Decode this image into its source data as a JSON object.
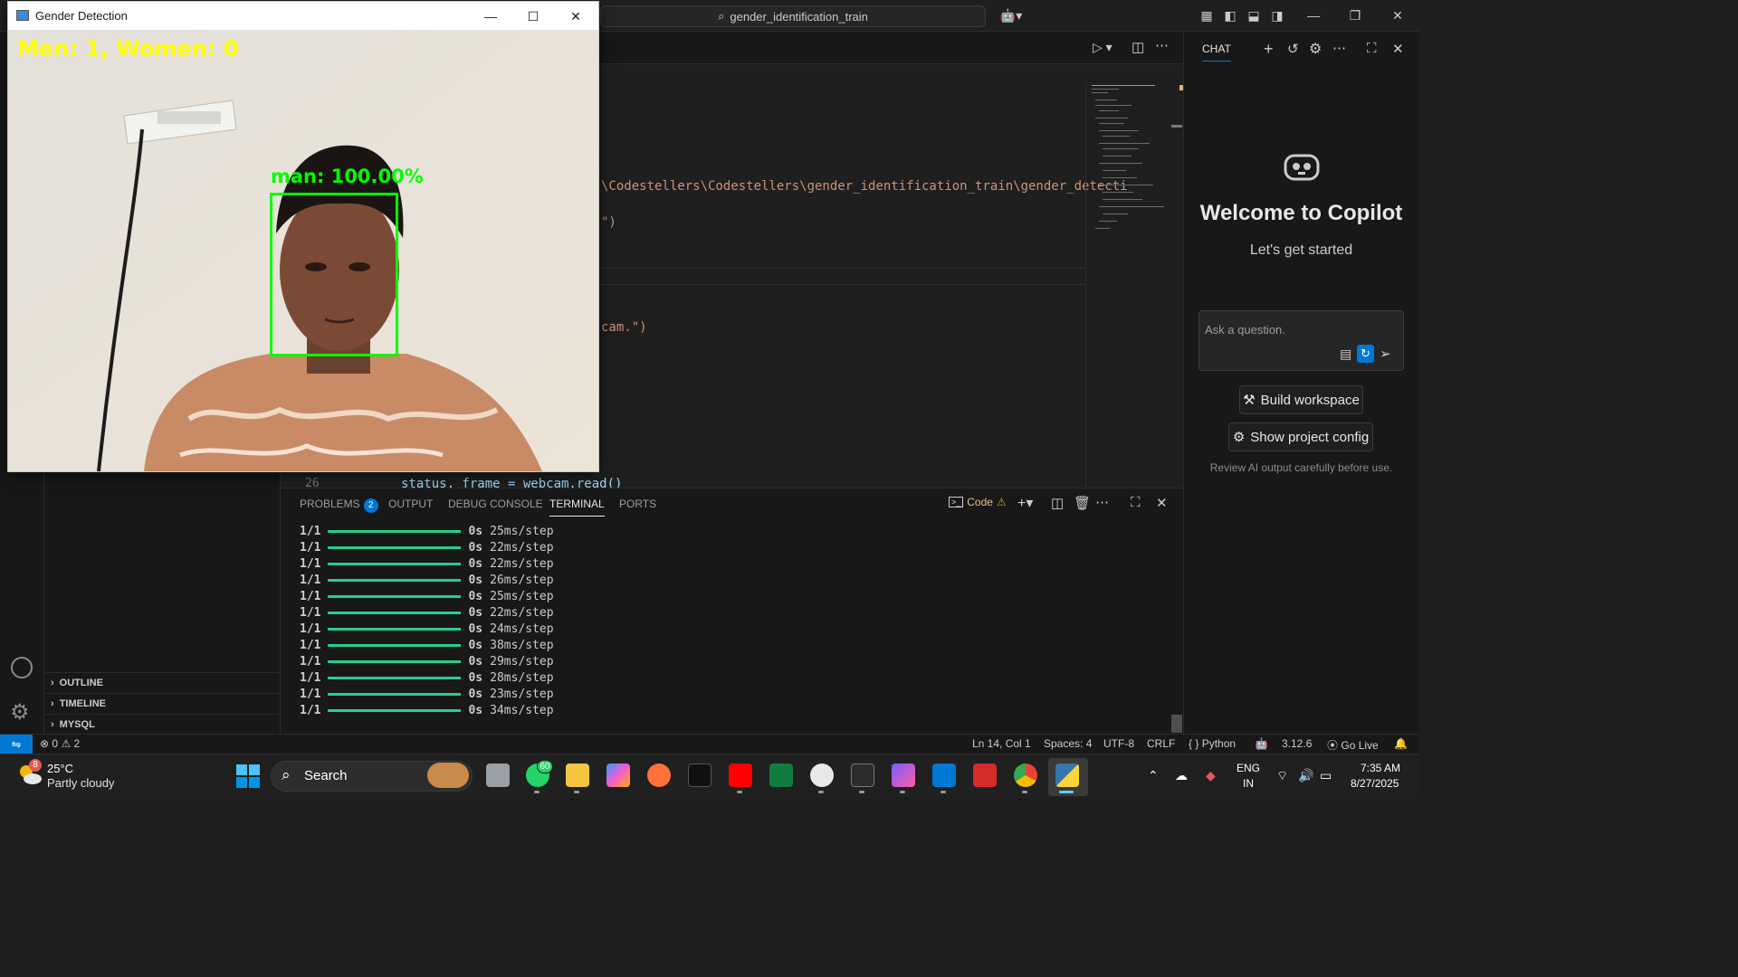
{
  "titlebar": {
    "search_text": "gender_identification_train"
  },
  "editor": {
    "path_line": "\\Codestellers\\Codestellers\\gender_identification_train\\gender_detecti",
    "line_b": "\")",
    "line_c": "cam.\")",
    "line_d_num": "26",
    "line_d": "status, frame = webcam.read()"
  },
  "sidebar": {
    "sections": [
      "OUTLINE",
      "TIMELINE",
      "MYSQL"
    ]
  },
  "panel": {
    "tabs": [
      "PROBLEMS",
      "OUTPUT",
      "DEBUG CONSOLE",
      "TERMINAL",
      "PORTS"
    ],
    "problems_count": "2",
    "terminal_name": "Code",
    "rows": [
      {
        "batch": "1/1",
        "time": "0s",
        "step": "25ms/step"
      },
      {
        "batch": "1/1",
        "time": "0s",
        "step": "22ms/step"
      },
      {
        "batch": "1/1",
        "time": "0s",
        "step": "22ms/step"
      },
      {
        "batch": "1/1",
        "time": "0s",
        "step": "26ms/step"
      },
      {
        "batch": "1/1",
        "time": "0s",
        "step": "25ms/step"
      },
      {
        "batch": "1/1",
        "time": "0s",
        "step": "22ms/step"
      },
      {
        "batch": "1/1",
        "time": "0s",
        "step": "24ms/step"
      },
      {
        "batch": "1/1",
        "time": "0s",
        "step": "38ms/step"
      },
      {
        "batch": "1/1",
        "time": "0s",
        "step": "29ms/step"
      },
      {
        "batch": "1/1",
        "time": "0s",
        "step": "28ms/step"
      },
      {
        "batch": "1/1",
        "time": "0s",
        "step": "23ms/step"
      },
      {
        "batch": "1/1",
        "time": "0s",
        "step": "34ms/step"
      }
    ]
  },
  "statusbar": {
    "errors": "0",
    "warnings": "2",
    "position": "Ln 14, Col 1",
    "spaces": "Spaces: 4",
    "encoding": "UTF-8",
    "eol": "CRLF",
    "language": "Python",
    "version": "3.12.6",
    "golive": "Go Live"
  },
  "chat": {
    "title": "CHAT",
    "welcome": "Welcome to Copilot",
    "subtitle": "Let's get started",
    "ask_placeholder": "Ask a question.",
    "build_label": "Build workspace",
    "config_label": "Show project config",
    "review": "Review AI output carefully before use."
  },
  "gender_window": {
    "title": "Gender Detection",
    "count_text": "Men: 1, Women: 0",
    "label": "man: 100.00%"
  },
  "taskbar": {
    "weather_temp": "25°C",
    "weather_desc": "Partly cloudy",
    "weather_badge": "8",
    "search_label": "Search",
    "whatsapp_badge": "60",
    "lang_top": "ENG",
    "lang_bottom": "IN",
    "time": "7:35 AM",
    "date": "8/27/2025"
  },
  "colors": {
    "accent": "#0078d4",
    "terminal_bar": "#23d18b",
    "overlay_yellow": "#ffff00",
    "overlay_green": "#00ff00"
  }
}
